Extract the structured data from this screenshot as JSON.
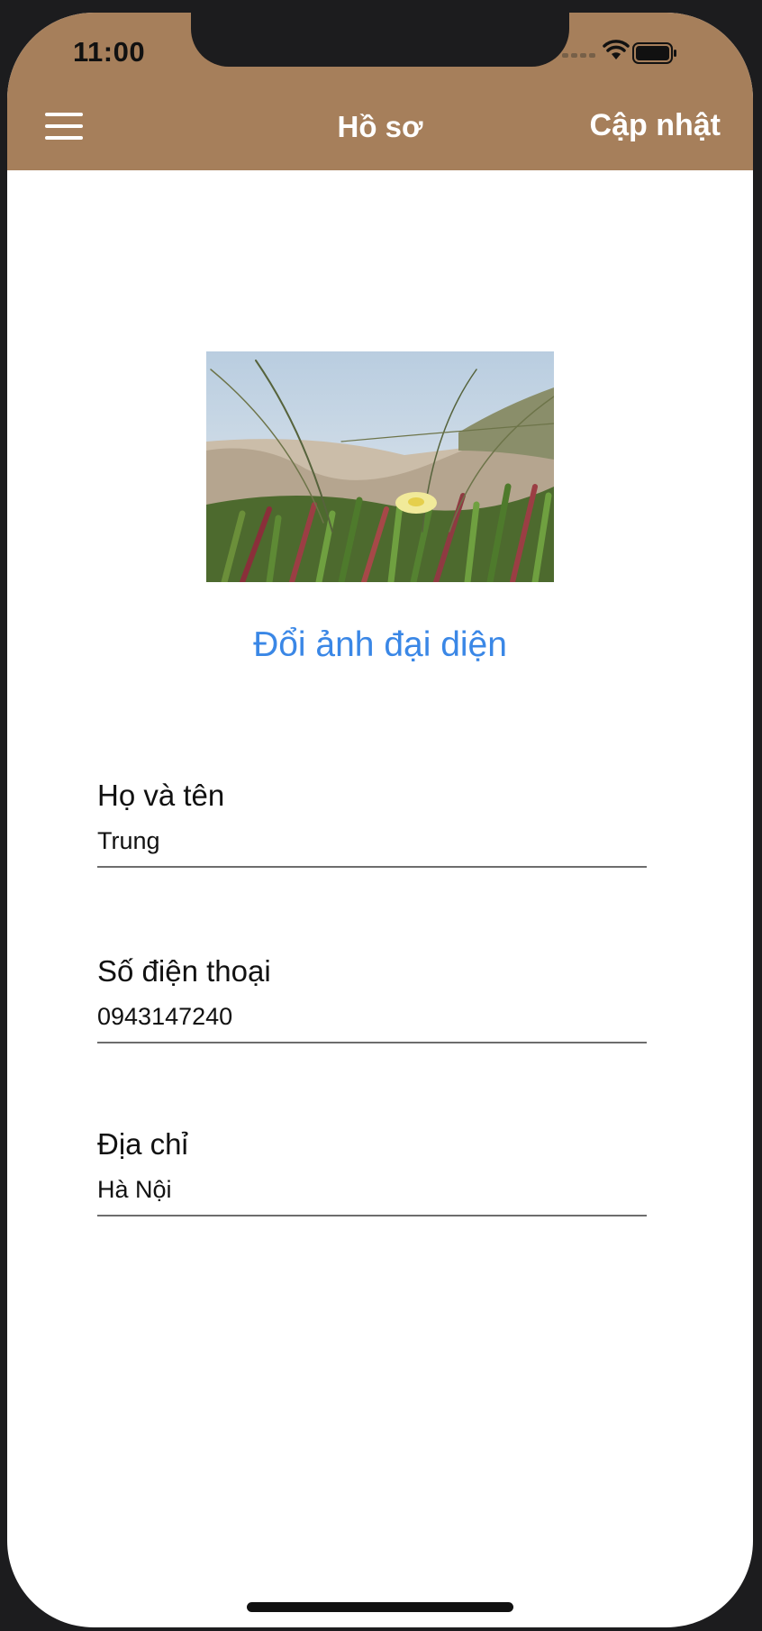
{
  "status_bar": {
    "time": "11:00"
  },
  "nav": {
    "title": "Hồ sơ",
    "update_label": "Cập nhật",
    "menu_icon": "hamburger-menu-icon"
  },
  "profile": {
    "change_avatar_label": "Đổi ảnh đại diện"
  },
  "fields": [
    {
      "label": "Họ và tên",
      "value": "Trung"
    },
    {
      "label": "Số điện thoại",
      "value": "0943147240"
    },
    {
      "label": "Địa chỉ",
      "value": "Hà Nội"
    }
  ],
  "colors": {
    "header": "#a67f5b",
    "link": "#3a87e6",
    "background": "#ffffff"
  }
}
